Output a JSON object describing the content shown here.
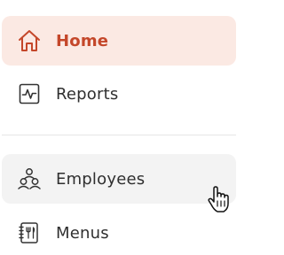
{
  "nav": {
    "items": [
      {
        "label": "Home",
        "icon": "home-icon",
        "state": "active"
      },
      {
        "label": "Reports",
        "icon": "reports-icon",
        "state": "default"
      },
      {
        "label": "Employees",
        "icon": "employees-icon",
        "state": "hover"
      },
      {
        "label": "Menus",
        "icon": "menus-icon",
        "state": "default"
      }
    ]
  },
  "colors": {
    "active_accent": "#c4472a",
    "active_background": "#fbe9e3",
    "hover_background": "#f3f3f3",
    "text": "#2f2f2f",
    "divider": "#e6e6e6"
  },
  "cursor": {
    "icon": "hand-pointer-icon"
  }
}
